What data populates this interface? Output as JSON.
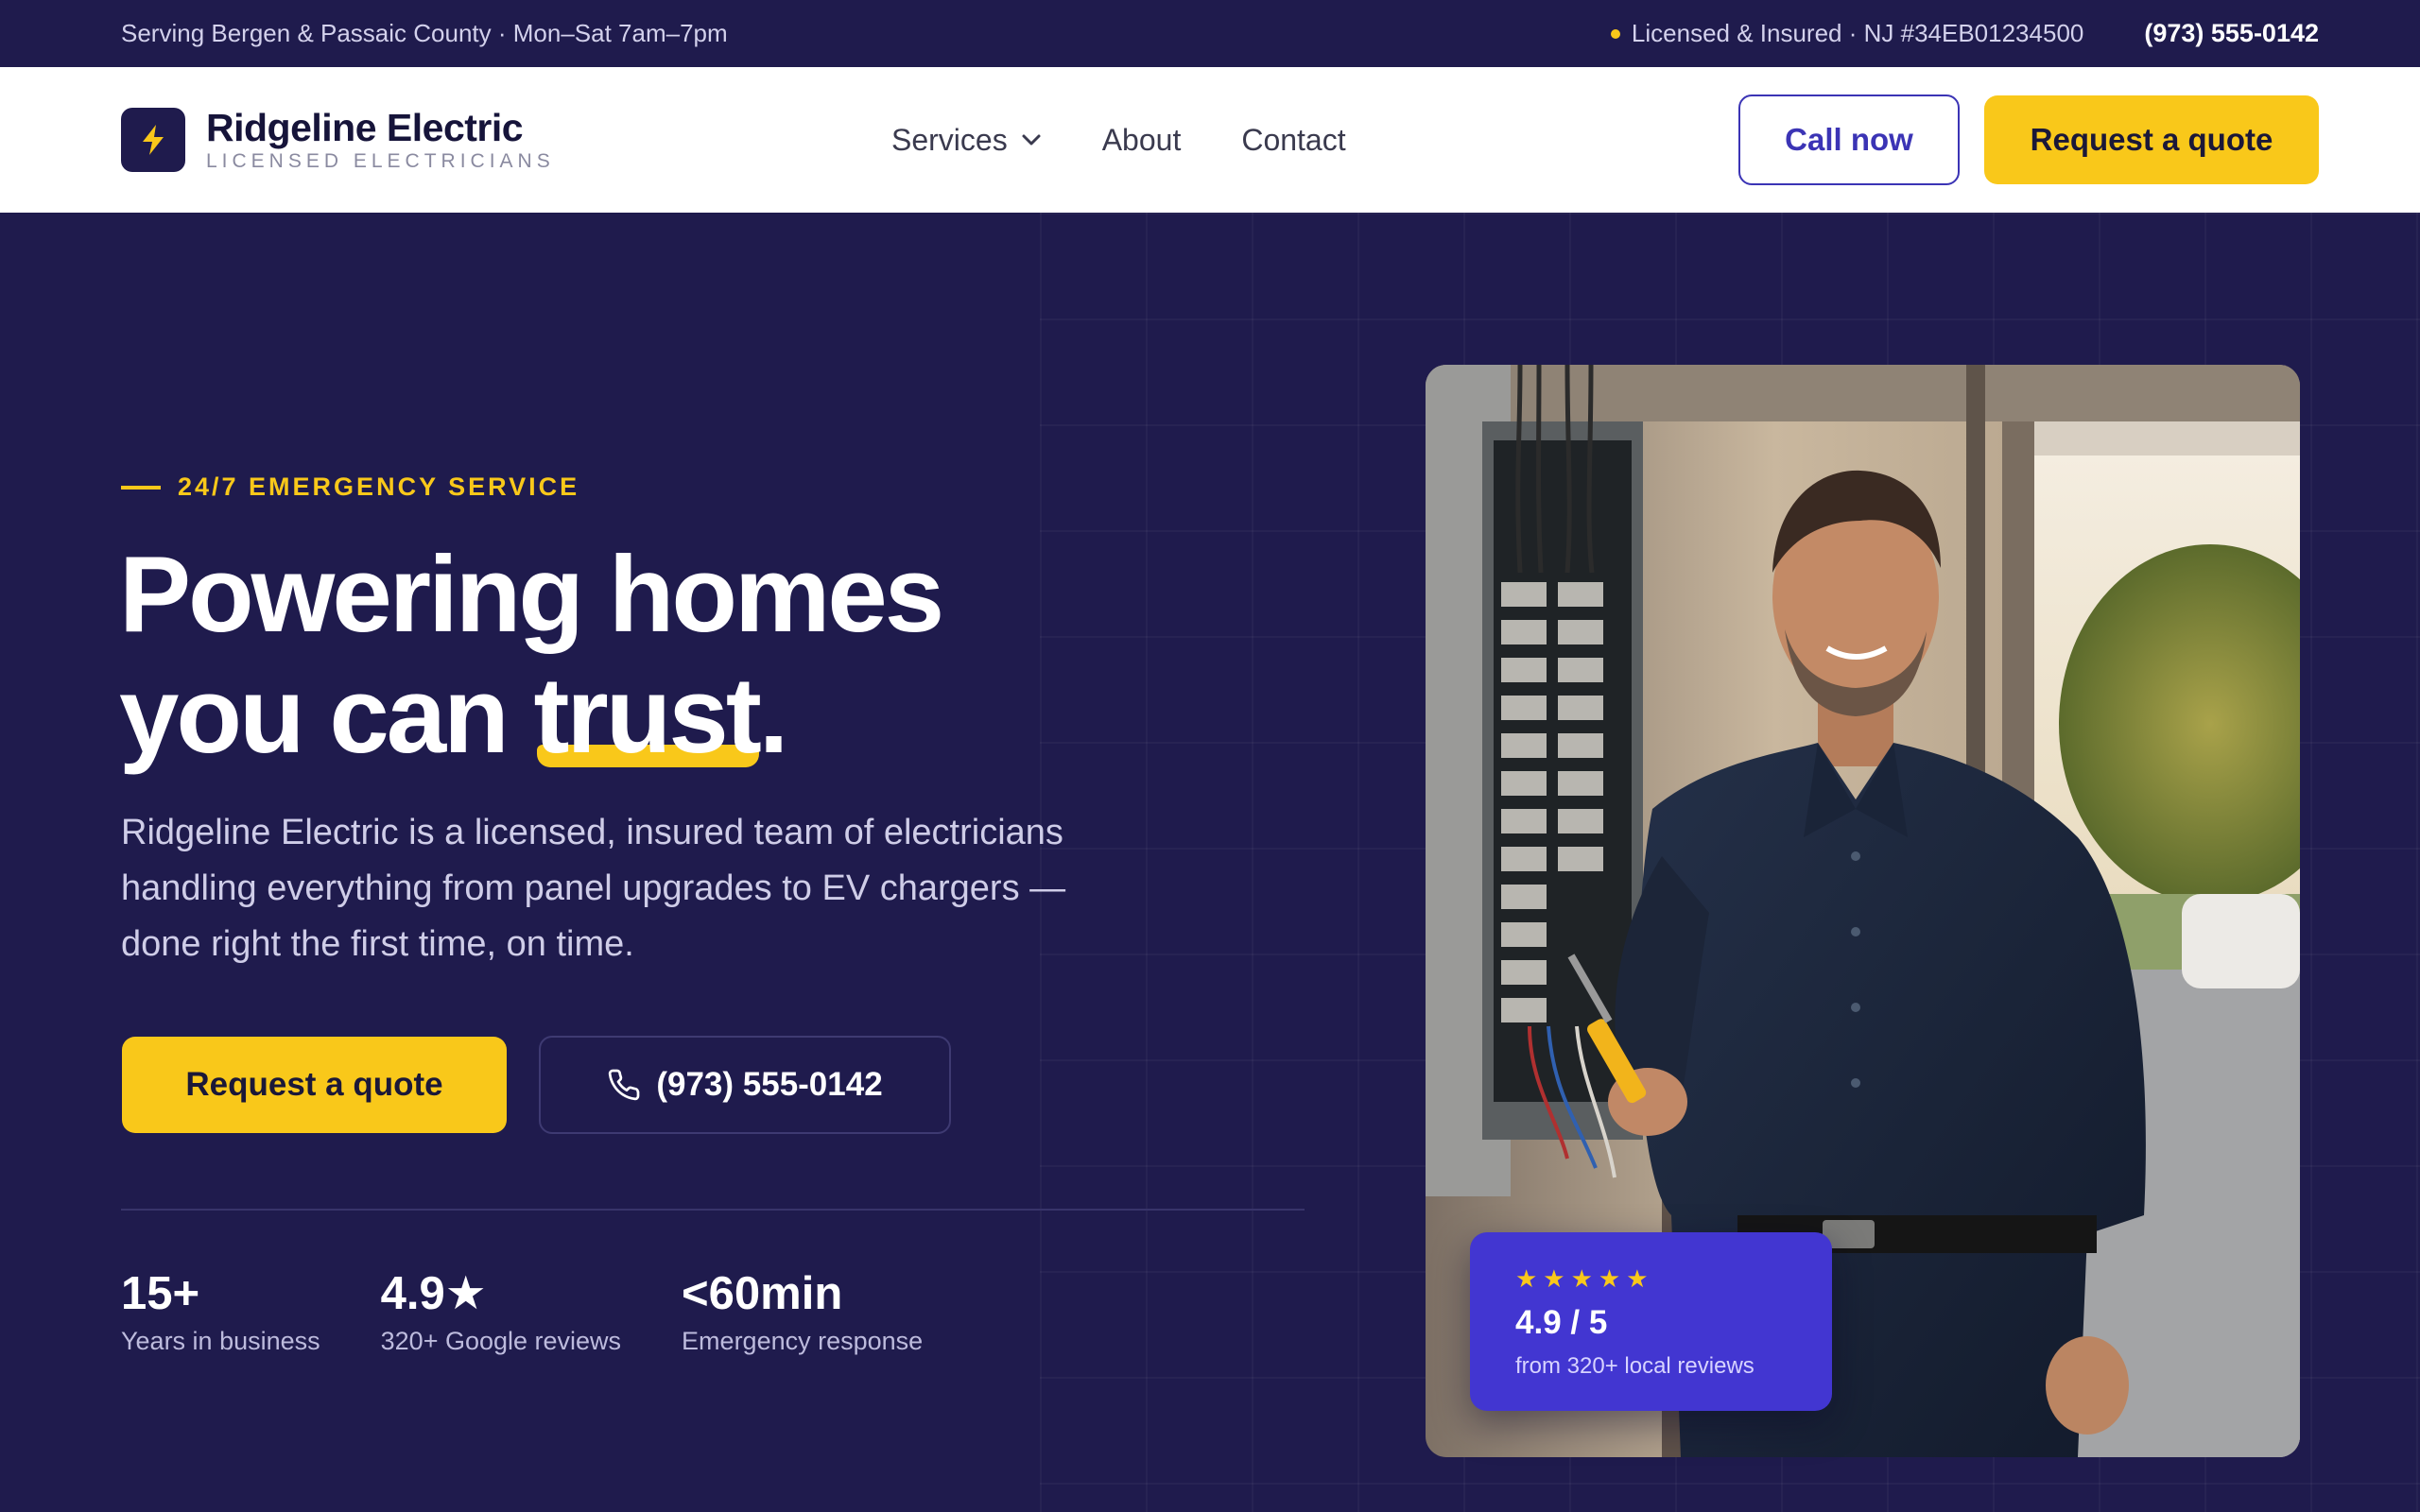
{
  "topbar": {
    "service_area": "Serving Bergen & Passaic County · Mon–Sat 7am–7pm",
    "license": "Licensed & Insured · NJ #34EB01234500",
    "phone": "(973) 555-0142"
  },
  "brand": {
    "name": "Ridgeline Electric",
    "tagline": "LICENSED ELECTRICIANS",
    "logo_icon": "lightning-bolt-icon"
  },
  "nav": {
    "links": [
      {
        "label": "Services",
        "has_dropdown": true
      },
      {
        "label": "About"
      },
      {
        "label": "Contact"
      }
    ],
    "call_label": "Call now",
    "quote_label": "Request a quote"
  },
  "hero": {
    "eyebrow": "24/7 EMERGENCY SERVICE",
    "headline_line1": "Powering homes",
    "headline_line2_pre": "you can ",
    "headline_highlight": "trust",
    "headline_period": ".",
    "subcopy": "Ridgeline Electric is a licensed, insured team of electricians handling everything from panel upgrades to EV chargers — done right the first time, on time.",
    "cta_primary": "Request a quote",
    "cta_phone": "(973) 555-0142",
    "stats": [
      {
        "value": "15+",
        "label": "Years in business"
      },
      {
        "value": "4.9★",
        "label": "320+ Google reviews"
      },
      {
        "value": "<60min",
        "label": "Emergency response"
      }
    ]
  },
  "rating_card": {
    "stars": "★★★★★",
    "value": "4.9 / 5",
    "subtext": "from 320+ local reviews"
  },
  "colors": {
    "navy": "#1f1b4d",
    "accent_yellow": "#f9c81a",
    "accent_indigo": "#4236d1",
    "outline_indigo": "#3b34b5"
  }
}
